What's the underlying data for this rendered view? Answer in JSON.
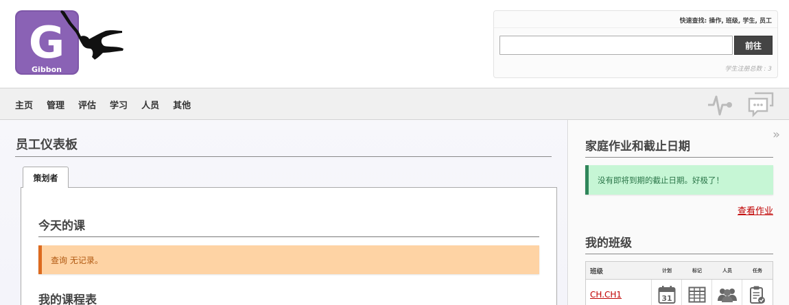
{
  "brand": {
    "logo_text": "Gibbon",
    "logo_letter": "G"
  },
  "quick_find": {
    "title": "快速查找: 操作, 班级, 学生, 员工",
    "input_value": "",
    "go_label": "前往",
    "student_count_label": "学生注册总数 :",
    "student_count": "3"
  },
  "nav": {
    "items": [
      {
        "label": "主页"
      },
      {
        "label": "管理"
      },
      {
        "label": "评估"
      },
      {
        "label": "学习"
      },
      {
        "label": "人员"
      },
      {
        "label": "其他"
      }
    ]
  },
  "main": {
    "page_title": "员工仪表板",
    "tab_label": "策划者",
    "lessons_title": "今天的课",
    "lessons_warning": "查询 无记录。",
    "schedule_title": "我的课程表"
  },
  "sidebar": {
    "collapse_glyph": "»",
    "homework_title": "家庭作业和截止日期",
    "homework_message": "没有即将到期的截止日期。好极了！",
    "homework_link": "查看作业",
    "classes_title": "我的班级",
    "table": {
      "headers": [
        "班级",
        "计划",
        "标记",
        "人员",
        "任务"
      ],
      "rows": [
        {
          "class": "CH.CH1"
        }
      ]
    }
  },
  "colors": {
    "warning_bg": "#fed3a4",
    "warning_border": "#dd6a1e",
    "success_bg": "#c6f6d5",
    "success_border": "#2f855a",
    "link": "#c00000",
    "logo_purple": "#7e57a8"
  }
}
